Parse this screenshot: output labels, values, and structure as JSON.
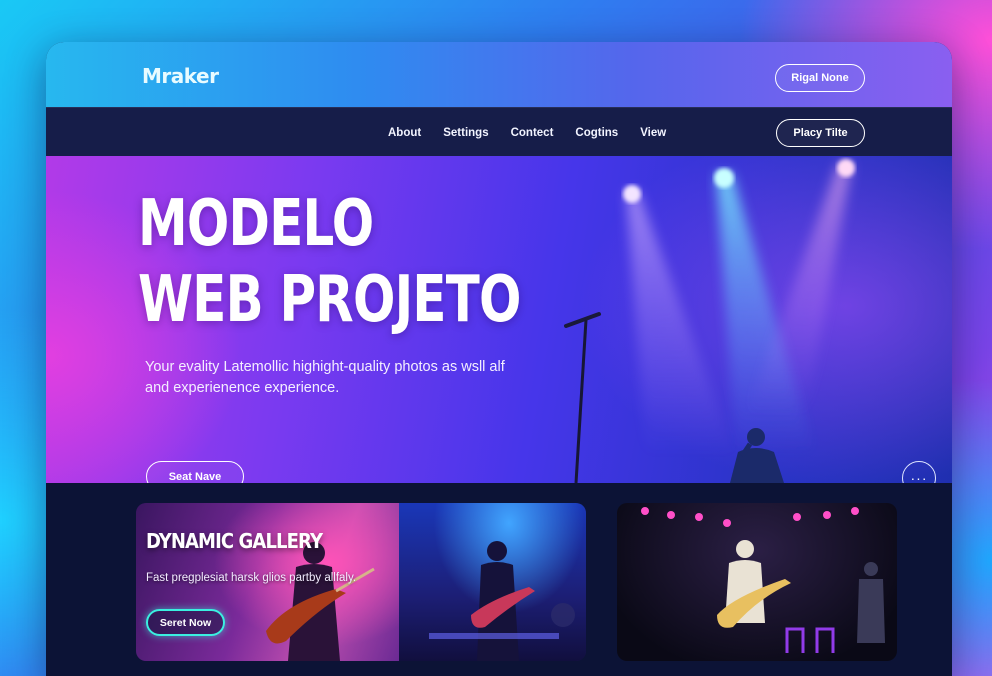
{
  "header": {
    "logo": "Mraker",
    "top_button_label": "Rigal None"
  },
  "nav": {
    "links": [
      "About",
      "Settings",
      "Contect",
      "Cogtins",
      "View"
    ],
    "button_label": "Placy Tilte"
  },
  "hero": {
    "title_line1": "MODELO",
    "title_line2": "WEB PROJETO",
    "subtitle": "Your evality Latemollic highight-quality photos as wsll alf and experienence experience.",
    "cta_label": "Seat Nave",
    "more_label": "···"
  },
  "gallery": {
    "title": "DYNAMIC GALLERY",
    "subtitle": "Fast pregplesiat harsk glios partby allfaly.",
    "cta_label": "Seret Now"
  },
  "colors": {
    "accent_cyan": "#3af0e0",
    "window_bg": "#0c1336",
    "navbar_bg": "#161d49"
  }
}
